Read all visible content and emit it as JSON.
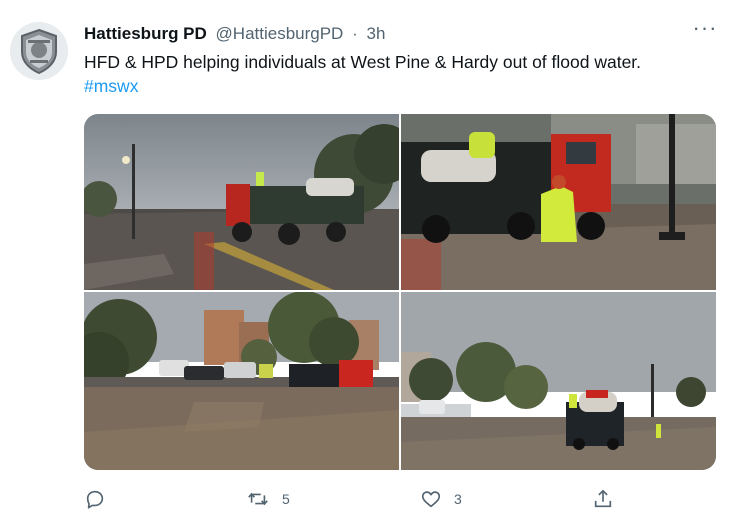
{
  "tweet": {
    "display_name": "Hattiesburg PD",
    "handle": "@HattiesburgPD",
    "separator": "·",
    "time": "3h",
    "more_label": "···",
    "text": "HFD & HPD helping individuals at West Pine & Hardy out of flood water.",
    "hashtag": "#mswx"
  },
  "media": [
    {
      "id": "photo-1",
      "subject": "flood-truck-on-flooded-street"
    },
    {
      "id": "photo-2",
      "subject": "rescuer-beside-red-truck-in-floodwater"
    },
    {
      "id": "photo-3",
      "subject": "flooded-intersection-with-truck"
    },
    {
      "id": "photo-4",
      "subject": "truck-driving-through-flood"
    }
  ],
  "actions": {
    "reply": {
      "icon": "reply-icon",
      "count": ""
    },
    "retweet": {
      "icon": "retweet-icon",
      "count": "5"
    },
    "like": {
      "icon": "heart-icon",
      "count": "3"
    },
    "share": {
      "icon": "share-icon",
      "count": ""
    }
  },
  "colors": {
    "link": "#1d9bf0",
    "muted": "#536471",
    "text": "#0f1419"
  }
}
